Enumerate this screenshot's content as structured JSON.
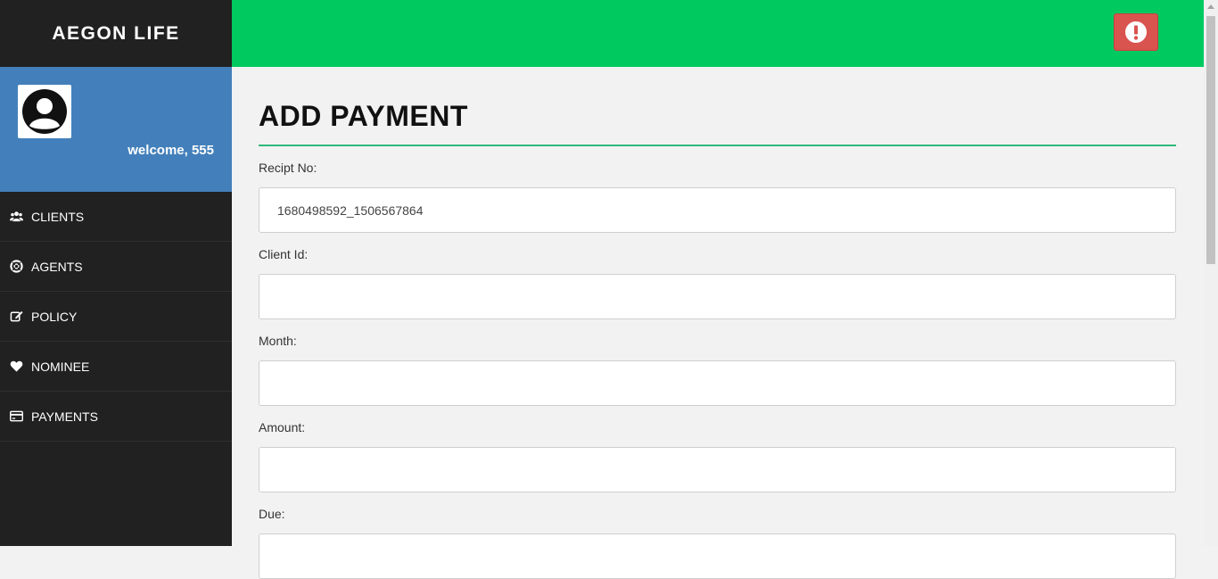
{
  "app": {
    "brand": "AEGON LIFE",
    "welcome": "welcome, 555"
  },
  "sidebar": {
    "items": [
      {
        "label": "CLIENTS",
        "icon": "users-icon"
      },
      {
        "label": "AGENTS",
        "icon": "life-ring-icon"
      },
      {
        "label": "POLICY",
        "icon": "edit-icon"
      },
      {
        "label": "NOMINEE",
        "icon": "heart-icon"
      },
      {
        "label": "PAYMENTS",
        "icon": "credit-card-icon"
      }
    ]
  },
  "header": {
    "alert_icon": "exclamation-circle-icon"
  },
  "form": {
    "title": "ADD PAYMENT",
    "fields": [
      {
        "label": "Recipt No:",
        "value": "1680498592_1506567864"
      },
      {
        "label": "Client Id:",
        "value": ""
      },
      {
        "label": "Month:",
        "value": ""
      },
      {
        "label": "Amount:",
        "value": ""
      },
      {
        "label": "Due:",
        "value": ""
      }
    ]
  },
  "colors": {
    "sidebar": "#212121",
    "profile": "#4380bb",
    "topbar": "#00c95f",
    "alert": "#d9534f",
    "accent": "#2fb87a"
  }
}
